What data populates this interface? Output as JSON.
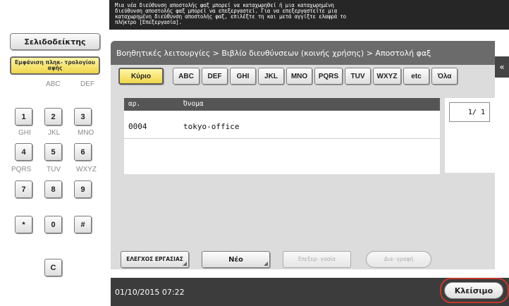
{
  "message": {
    "lines": [
      "Μια νέα διεύθυνση αποστολής φαξ μπορεί να καταχωρηθεί ή μια καταχωρημένη",
      "διεύθυνση αποστολής φαξ μπορεί να επεξεργαστεί. Για να επεξεργαστείτε μια",
      "καταχωρημένη διεύθυνση αποστολής φαξ, επιλέξτε τη και μετά αγγίξτε ελαφρά το",
      "πλήκτρο [Επεξεργασία]."
    ]
  },
  "left": {
    "bookmark_label": "Σελιδοδείκτης",
    "display_keypad_label": "Εμφάνιση πληκ- τρολογίου αφής",
    "keypad": {
      "letters": [
        "ABC",
        "DEF",
        "GHI",
        "JKL",
        "MNO",
        "PQRS",
        "TUV",
        "WXYZ"
      ],
      "keys": [
        "1",
        "2",
        "3",
        "4",
        "5",
        "6",
        "7",
        "8",
        "9",
        "*",
        "0",
        "#"
      ],
      "clear_label": "C"
    }
  },
  "breadcrumb": "Βοηθητικές λειτουργίες > Βιβλίο διευθύνσεων (κοινής χρήσης) > Αποστολή φαξ",
  "collapse_icon": "«",
  "index_tabs": [
    "Κύριο",
    "ABC",
    "DEF",
    "GHI",
    "JKL",
    "MNO",
    "PQRS",
    "TUV",
    "WXYZ",
    "etc",
    "Όλα"
  ],
  "table": {
    "columns": [
      "αρ.",
      "Όνομα"
    ],
    "rows": [
      {
        "no": "0004",
        "name": "tokyo-office"
      }
    ]
  },
  "page_indicator": "1/  1",
  "actions": {
    "check_job_label": "ΕΛΕΓΧΟΣ ΕΡΓΑΣΙΑΣ",
    "new_label": "Νέο",
    "edit_label": "Επεξερ- γασία",
    "delete_label": "Δια- γραφή"
  },
  "status": {
    "datetime": "01/10/2015   07:22"
  },
  "close_label": "Κλείσιμο"
}
